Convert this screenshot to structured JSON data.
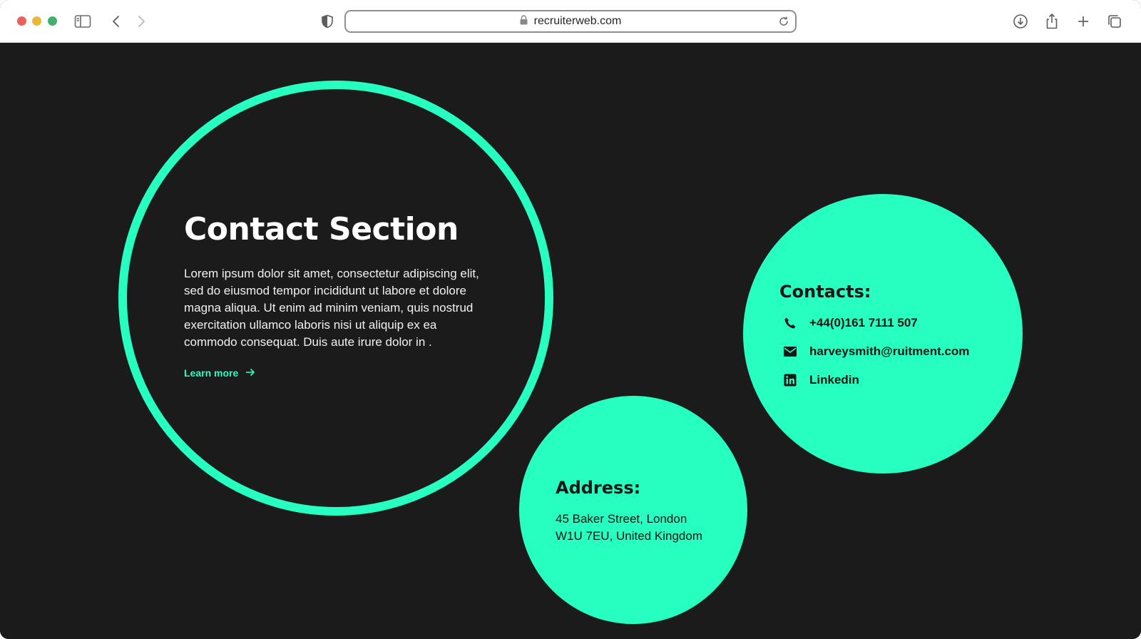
{
  "browser": {
    "url": "recruiterweb.com"
  },
  "hero": {
    "title": "Contact Section",
    "body": "Lorem ipsum dolor sit amet, consectetur adipiscing elit, sed do eiusmod tempor incididunt ut labore et dolore magna aliqua. Ut enim ad minim veniam, quis nostrud exercitation ullamco laboris nisi ut aliquip ex ea commodo consequat. Duis aute irure dolor in .",
    "link_label": "Learn more"
  },
  "contacts": {
    "title": "Contacts:",
    "phone": "+44(0)161 7111 507",
    "email": "harveysmith@ruitment.com",
    "linkedin": "Linkedin"
  },
  "address": {
    "title": "Address:",
    "line1": "45 Baker Street, London",
    "line2": "W1U 7EU, United Kingdom"
  },
  "colors": {
    "accent": "#26ffc0",
    "background": "#1b1b1b"
  }
}
